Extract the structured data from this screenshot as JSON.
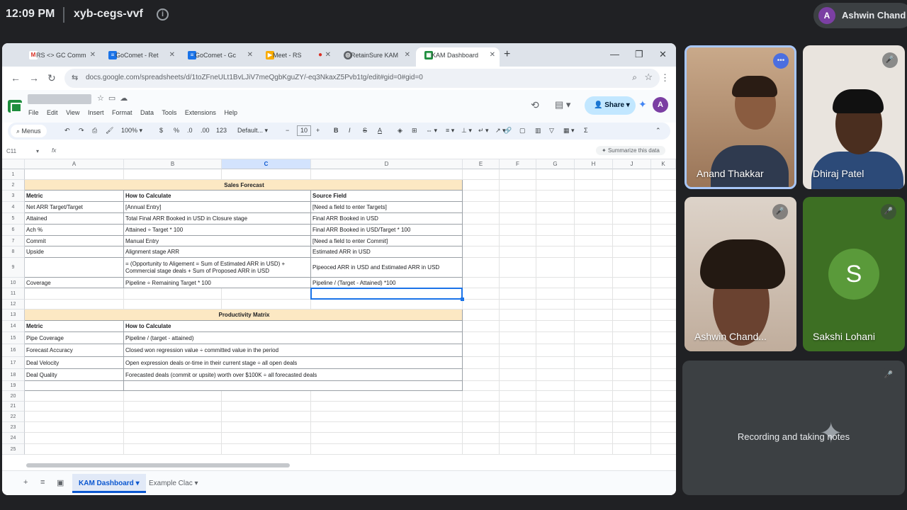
{
  "meet": {
    "time": "12:09 PM",
    "meeting_code": "xyb-cegs-vvf",
    "self_name": "Ashwin Chand",
    "self_initial": "A"
  },
  "browser": {
    "tabs": [
      {
        "label": "RS <> GC Comm",
        "favicon": "gmail-icon",
        "color": "#d93025"
      },
      {
        "label": "GoComet - Ret",
        "favicon": "docs-icon",
        "color": "#1a73e8"
      },
      {
        "label": "GoComet - Gc",
        "favicon": "docs-icon",
        "color": "#1a73e8"
      },
      {
        "label": "Meet - RS",
        "favicon": "meet-icon",
        "color": "#f9ab00"
      },
      {
        "label": "RetainSure KAM",
        "favicon": "globe-icon",
        "color": "#5f6368"
      },
      {
        "label": "KAM Dashboard",
        "favicon": "sheets-icon",
        "color": "#1e8e3e"
      }
    ],
    "url": "docs.google.com/spreadsheets/d/1toZFneULt1BvLJiV7meQgbKguZY/-eq3NkaxZ5Pvb1tg/edit#gid=0#gid=0"
  },
  "sheets": {
    "menu": [
      "File",
      "Edit",
      "View",
      "Insert",
      "Format",
      "Data",
      "Tools",
      "Extensions",
      "Help"
    ],
    "share_label": "Share",
    "avatar_initial": "A",
    "toolbar": {
      "menus_label": "Menus",
      "zoom": "100%",
      "currency": "$",
      "percent": "%",
      "dec_dec": ".0",
      "dec_inc": ".00",
      "number_format": "123",
      "font": "Default...",
      "font_size": "10"
    },
    "name_box": "C11",
    "fx_label": "fx",
    "summarize_label": "Summarize this data",
    "columns": [
      "A",
      "B",
      "C",
      "D",
      "E",
      "F",
      "G",
      "H",
      "J",
      "K"
    ],
    "row_numbers": [
      "1",
      "2",
      "3",
      "4",
      "5",
      "6",
      "7",
      "8",
      "9",
      "10",
      "11",
      "12",
      "13",
      "14",
      "15",
      "16",
      "17",
      "18",
      "19",
      "20",
      "21",
      "22",
      "23",
      "24",
      "25"
    ],
    "sales_forecast": {
      "title": "Sales Forecast",
      "headers": [
        "Metric",
        "How to Calculate",
        "Source Field"
      ],
      "rows": [
        [
          "Net ARR Target/Target",
          "[Annual Entry]",
          "[Need a field to enter Targets]"
        ],
        [
          "Attained",
          "Total Final ARR Booked in USD in Closure stage",
          "Final ARR Booked in USD"
        ],
        [
          "Ach %",
          "Attained ÷ Target * 100",
          "Final ARR Booked in USD/Target * 100"
        ],
        [
          "Commit",
          "Manual Entry",
          "[Need a field to enter Commit]"
        ],
        [
          "Upside",
          "Alignment stage ARR",
          "Estimated ARR in USD"
        ],
        [
          "",
          "= (Opportunity to Aligement = Sum of Estimated ARR in USD) + Commercial stage deals + Sum of Proposed ARR in USD",
          "Pipeoced ARR in USD and Estimated ARR in USD"
        ],
        [
          "Coverage",
          "Pipeline ÷ Remaining Target * 100",
          "Pipeline / (Target - Attained) *100"
        ]
      ]
    },
    "productivity": {
      "title": "Productivity Matrix",
      "headers": [
        "Metric",
        "How to Calculate"
      ],
      "rows": [
        [
          "Pipe Coverage",
          "Pipeline / (target - attained)"
        ],
        [
          "Forecast Accuracy",
          "Closed won regression value ÷ committed value in the period"
        ],
        [
          "Deal Velocity",
          "Open expression deals or-time in their current stage ÷ all open deals"
        ],
        [
          "Deal Quality",
          "Forecasted deals (commit or upsite) worth over $100K ÷ all forecasted deals"
        ]
      ]
    },
    "sheet_tabs": [
      "KAM Dashboard",
      "Example Clac"
    ]
  },
  "participants": [
    {
      "name": "Anand Thakkar",
      "active_speaker": true
    },
    {
      "name": "Dhiraj Patel",
      "muted": true
    },
    {
      "name": "Ashwin Chand...",
      "muted": true
    },
    {
      "name": "Sakshi Lohani",
      "initial": "S",
      "muted": true
    }
  ],
  "notes_tile": {
    "text": "Recording and taking notes"
  }
}
